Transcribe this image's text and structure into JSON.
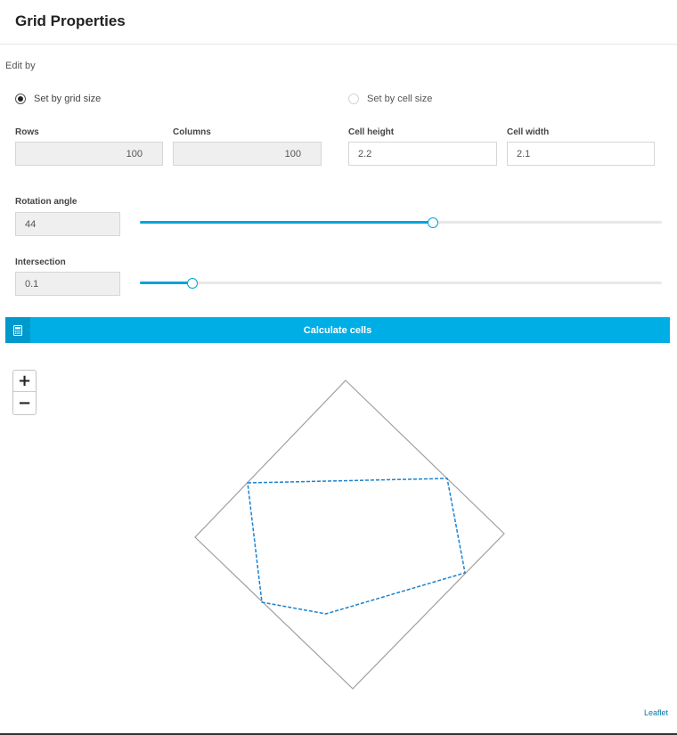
{
  "header": {
    "title": "Grid Properties"
  },
  "edit_by": {
    "label": "Edit by",
    "options": [
      {
        "label": "Set by grid size",
        "checked": true
      },
      {
        "label": "Set by cell size",
        "checked": false
      }
    ]
  },
  "fields": {
    "rows": {
      "label": "Rows",
      "value": "100"
    },
    "columns": {
      "label": "Columns",
      "value": "100"
    },
    "cell_height": {
      "label": "Cell height",
      "value": "2.2"
    },
    "cell_width": {
      "label": "Cell width",
      "value": "2.1"
    }
  },
  "rotation": {
    "label": "Rotation angle",
    "value": "44",
    "slider_fraction": 0.561
  },
  "intersection": {
    "label": "Intersection",
    "value": "0.1",
    "slider_fraction": 0.1
  },
  "calculate": {
    "label": "Calculate cells",
    "icon": "calculator-icon"
  },
  "map": {
    "zoom_in": "+",
    "zoom_out": "−",
    "attribution": "Leaflet",
    "boundary_color": "#a0a0a0",
    "polygon_color": "#1a82d0"
  },
  "colors": {
    "accent": "#00aee6",
    "slider": "#00a4d8"
  }
}
